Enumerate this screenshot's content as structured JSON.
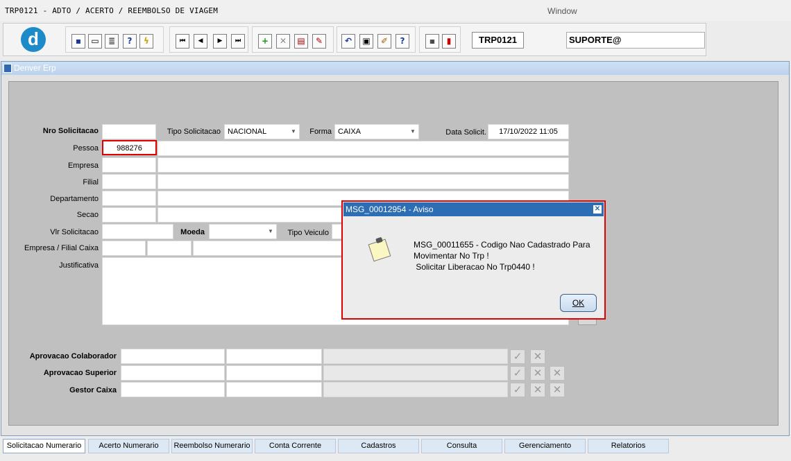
{
  "app": {
    "title": "TRP0121 - ADTO / ACERTO / REEMBOLSO DE VIAGEM",
    "window_menu": "Window"
  },
  "toolbar": {
    "logo_letter": "d",
    "form_code": "TRP0121",
    "user": "SUPORTE@"
  },
  "window": {
    "title": "Denver Erp"
  },
  "form": {
    "nro_solicitacao": {
      "label": "Nro Solicitacao",
      "value": ""
    },
    "tipo_solicitacao": {
      "label": "Tipo Solicitacao",
      "value": "NACIONAL"
    },
    "forma": {
      "label": "Forma",
      "value": "CAIXA"
    },
    "data_solicit": {
      "label": "Data Solicit.",
      "value": "17/10/2022 11:05"
    },
    "pessoa": {
      "label": "Pessoa",
      "code": "988276",
      "name": ""
    },
    "empresa": {
      "label": "Empresa"
    },
    "filial": {
      "label": "Filial"
    },
    "departamento": {
      "label": "Departamento"
    },
    "secao": {
      "label": "Secao"
    },
    "vlr_solicitacao": {
      "label": "Vlr Solicitacao"
    },
    "moeda": {
      "label": "Moeda"
    },
    "tipo_veiculo": {
      "label": "Tipo Veiculo"
    },
    "empresa_filial_caixa": {
      "label": "Empresa / Filial Caixa"
    },
    "justificativa": {
      "label": "Justificativa"
    }
  },
  "approvals": [
    {
      "label": "Aprovacao Colaborador"
    },
    {
      "label": "Aprovacao Superior"
    },
    {
      "label": "Gestor Caixa"
    }
  ],
  "tabs": [
    "Solicitacao Numerario",
    "Acerto Numerario",
    "Reembolso Numerario",
    "Conta Corrente",
    "Cadastros",
    "Consulta",
    "Gerenciamento",
    "Relatorios"
  ],
  "dialog": {
    "title": "MSG_00012954 - Aviso",
    "line1": "MSG_00011655 - Codigo Nao Cadastrado Para",
    "line2": "Movimentar No Trp !",
    "line3": " Solicitar Liberacao No Trp0440 !",
    "ok_label": "OK"
  },
  "colors": {
    "accent": "#2c6db3",
    "highlight": "#e00000",
    "canvas": "#c0c0c0"
  }
}
